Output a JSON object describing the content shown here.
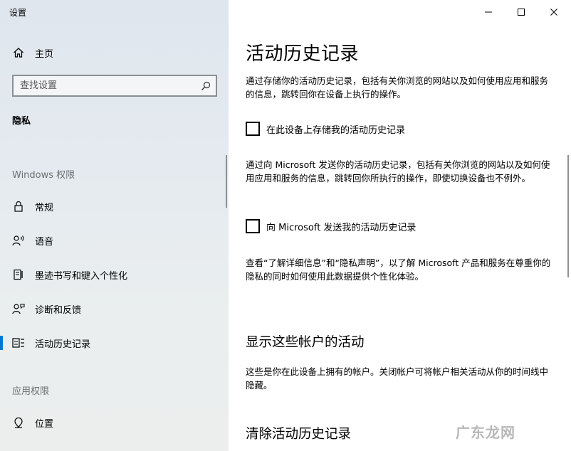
{
  "window": {
    "title": "设置"
  },
  "sidebar": {
    "home_label": "主页",
    "search_placeholder": "查找设置",
    "category_label": "隐私",
    "windows_permissions_label": "Windows 权限",
    "items": [
      {
        "label": "常规",
        "icon": "lock-icon"
      },
      {
        "label": "语音",
        "icon": "speech-icon"
      },
      {
        "label": "墨迹书写和键入个性化",
        "icon": "ink-icon"
      },
      {
        "label": "诊断和反馈",
        "icon": "feedback-icon"
      },
      {
        "label": "活动历史记录",
        "icon": "activity-history-icon",
        "selected": true
      }
    ],
    "app_permissions_label": "应用权限",
    "app_items": [
      {
        "label": "位置",
        "icon": "location-icon"
      }
    ],
    "accent_color": "#0078d7"
  },
  "main": {
    "title": "活动历史记录",
    "intro_text": "通过存储你的活动历史记录，包括有关你浏览的网站以及如何使用应用和服务的信息，跳转回你在设备上执行的操作。",
    "checkbox_local_label": "在此设备上存储我的活动历史记录",
    "checkbox_local_checked": false,
    "microsoft_text": "通过向 Microsoft 发送你的活动历史记录，包括有关你浏览的网站以及如何使用应用和服务的信息，跳转回你所执行的操作，即使切换设备也不例外。",
    "checkbox_send_label": "向 Microsoft 发送我的活动历史记录",
    "checkbox_send_checked": false,
    "learn_more_text": "查看“了解详细信息”和“隐私声明”，以了解 Microsoft 产品和服务在尊重你的隐私的同时如何使用此数据提供个性化体验。",
    "accounts_title": "显示这些帐户的活动",
    "accounts_text": "这些是你在此设备上拥有的帐户。关闭帐户可将帐户相关活动从你的时间线中隐藏。",
    "clear_title": "清除活动历史记录"
  },
  "watermark": "广东龙网"
}
